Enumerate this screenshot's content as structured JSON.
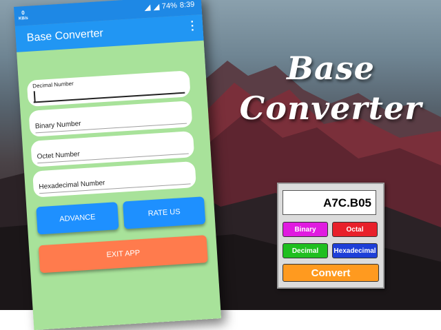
{
  "promo": {
    "title_line1": "Base",
    "title_line2": "Converter"
  },
  "status_bar": {
    "net_speed": "0",
    "net_unit": "KB/s",
    "battery": "74%",
    "time": "8:39"
  },
  "app_bar": {
    "title": "Base Converter",
    "menu_icon": "more-vert-icon"
  },
  "fields": {
    "decimal": "Decimal Number",
    "binary": "Binary Number",
    "octet": "Octet Number",
    "hex": "Hexadecimal Number"
  },
  "buttons": {
    "advance": "ADVANCE",
    "rate_us": "RATE US",
    "exit_app": "EXIT APP"
  },
  "widget": {
    "display": "A7C.B05",
    "binary": "Binary",
    "octal": "Octal",
    "decimal": "Decimal",
    "hexadecimal": "Hexadecimal",
    "convert": "Convert",
    "colors": {
      "binary": "#e01be0",
      "octal": "#e8202a",
      "decimal": "#1fbf1f",
      "hexadecimal": "#1e3fd8",
      "convert": "#ff9a1f"
    }
  },
  "colors": {
    "primary": "#2196f3",
    "status_bar": "#1e88e5",
    "content_bg": "#a8e29a",
    "blue_button": "#1e90ff",
    "orange_button": "#ff7b4d"
  }
}
